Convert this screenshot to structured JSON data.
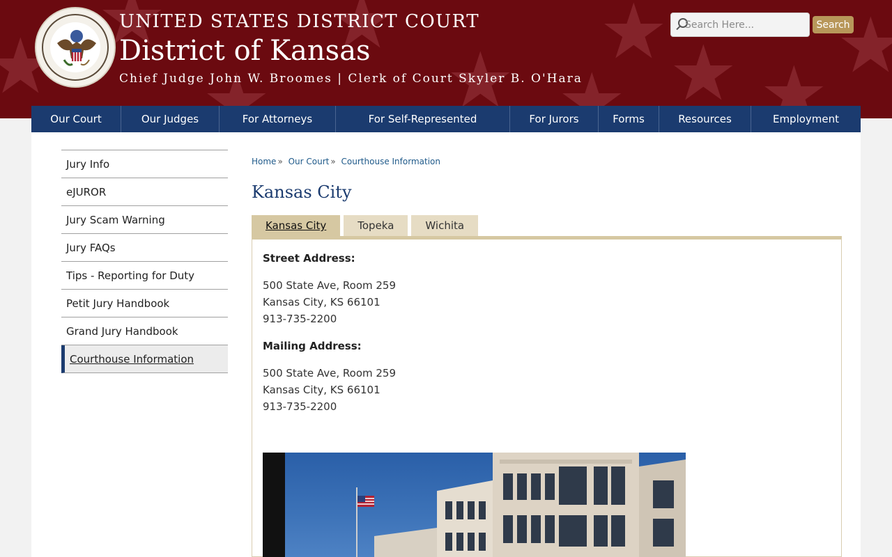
{
  "header": {
    "court_name": "UNITED STATES DISTRICT COURT",
    "district_name": "District of Kansas",
    "judges_line": "Chief Judge John W. Broomes | Clerk of Court Skyler B. O'Hara",
    "seal_icon": "court-seal-icon",
    "brand_color": "#6b0a10"
  },
  "search": {
    "placeholder": "Search Here...",
    "button_label": "Search"
  },
  "nav": {
    "items": [
      {
        "label": "Our Court"
      },
      {
        "label": "Our Judges"
      },
      {
        "label": "For Attorneys"
      },
      {
        "label": "For Self-Represented"
      },
      {
        "label": "For Jurors"
      },
      {
        "label": "Forms"
      },
      {
        "label": "Resources"
      },
      {
        "label": "Employment"
      }
    ],
    "color": "#1b3b6f"
  },
  "sidebar": {
    "items": [
      {
        "label": "Jury Info"
      },
      {
        "label": "eJUROR"
      },
      {
        "label": "Jury Scam Warning"
      },
      {
        "label": "Jury FAQs"
      },
      {
        "label": "Tips - Reporting for Duty"
      },
      {
        "label": "Petit Jury Handbook"
      },
      {
        "label": "Grand Jury Handbook"
      },
      {
        "label": "Courthouse Information",
        "active": true
      }
    ]
  },
  "breadcrumb": {
    "items": [
      {
        "label": "Home"
      },
      {
        "label": "Our Court"
      },
      {
        "label": "Courthouse Information"
      }
    ],
    "separator": "»"
  },
  "page": {
    "title": "Kansas City"
  },
  "tabs": {
    "items": [
      {
        "label": "Kansas City",
        "active": true
      },
      {
        "label": "Topeka"
      },
      {
        "label": "Wichita"
      }
    ],
    "active_color": "#d6c8a2"
  },
  "panel": {
    "street_label": "Street Address:",
    "street_lines": [
      "500 State Ave, Room 259",
      "Kansas City, KS 66101",
      "913-735-2200"
    ],
    "mailing_label": "Mailing Address:",
    "mailing_lines": [
      "500 State Ave, Room 259",
      "Kansas City, KS 66101",
      "913-735-2200"
    ]
  }
}
